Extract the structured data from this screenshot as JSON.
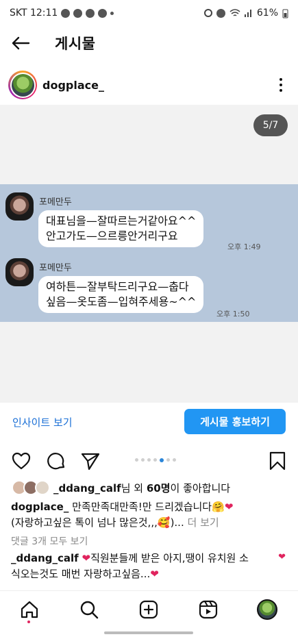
{
  "status_bar": {
    "carrier_time": "SKT 12:11",
    "battery": "61%"
  },
  "header": {
    "title": "게시물"
  },
  "post": {
    "username": "dogplace_",
    "page_indicator": "5/7",
    "carousel": {
      "count": 7,
      "active_index": 4
    },
    "chat": {
      "messages": [
        {
          "sender": "포메만두",
          "lines": [
            "대표님을—잘따르는거같아요^^",
            "안고가도—으르릉안거리구요"
          ],
          "time": "오후 1:49"
        },
        {
          "sender": "포메만두",
          "lines": [
            "여하튼—잘부탁드리구요—춥다",
            "싶음—옷도좀—입혀주세용~^^"
          ],
          "time": "오후 1:50"
        }
      ]
    }
  },
  "actions": {
    "insight_label": "인사이트 보기",
    "promote_label": "게시물 홍보하기"
  },
  "likes": {
    "user": "_ddang_calf",
    "mid": "님 외 ",
    "count": "60명",
    "suffix": "이 좋아합니다"
  },
  "caption": {
    "user": "dogplace_",
    "line1": " 만족만족대만족!만 드리겠습니다",
    "emoji1": "🤗",
    "heart1": "❤",
    "line2": "(자랑하고싶은 톡이 넘나 많은것,,,",
    "emoji2": "🥰",
    "ellipsis": ")... ",
    "more": "더 보기"
  },
  "comments_link": "댓글 3개 모두 보기",
  "comment": {
    "user": "_ddang_calf",
    "heart": "❤",
    "text1": "직원분들께 받은 아지,땡이 유치원 소",
    "text2": "식오는것도 매번 자랑하고싶음...",
    "heart2": "❤"
  },
  "colors": {
    "accent": "#2196f3",
    "link": "#1a6fd6",
    "chat_bg": "#b6c7db",
    "heart": "#e0245e"
  },
  "icons": [
    "back-arrow-icon",
    "more-vertical-icon",
    "heart-icon",
    "comment-icon",
    "share-icon",
    "bookmark-icon",
    "home-icon",
    "search-icon",
    "create-icon",
    "reels-icon"
  ]
}
